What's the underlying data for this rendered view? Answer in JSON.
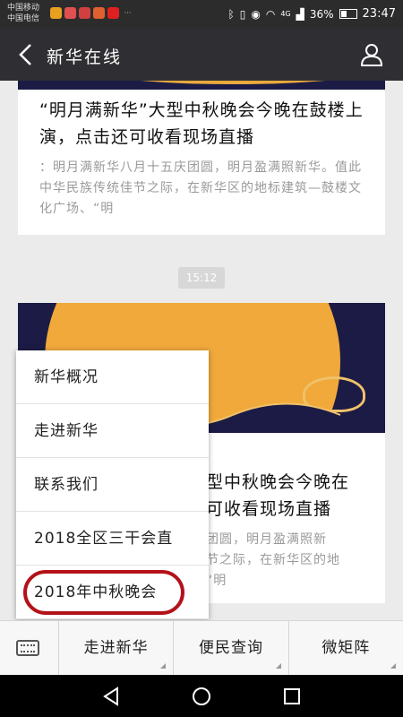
{
  "status_bar": {
    "carrier_line1": "中国移动",
    "carrier_line2": "中国电信",
    "network": "4G",
    "battery": "36%",
    "time": "23:47"
  },
  "nav": {
    "title": "新华在线",
    "back_icon": "back-arrow-icon",
    "profile_icon": "person-icon"
  },
  "articles": [
    {
      "title": "“明月满新华”大型中秋晚会今晚在鼓楼上演，点击还可收看现场直播",
      "summary": "：明月满新华八月十五庆团圆，明月盈满照新华。值此中华民族传统佳节之际，在新华区的地标建筑—鼓楼文化广场、“明"
    },
    {
      "title": "型中秋晚会今晚在\n可收看现场直播",
      "summary": "团圆，明月盈满照新\n节之际，在新华区的地\n“明"
    }
  ],
  "timestamp": "15:12",
  "popup_menu": {
    "items": [
      "新华概况",
      "走进新华",
      "联系我们",
      "2018全区三干会直",
      "2018年中秋晚会"
    ]
  },
  "bottom_menu": {
    "keyboard_icon": "keyboard-icon",
    "items": [
      "走进新华",
      "便民查询",
      "微矩阵"
    ]
  },
  "colors": {
    "nav_bg": "#2f2f33",
    "banner_bg": "#1b1b45",
    "moon": "#f0a93a",
    "highlight_circle": "#b3121a"
  }
}
